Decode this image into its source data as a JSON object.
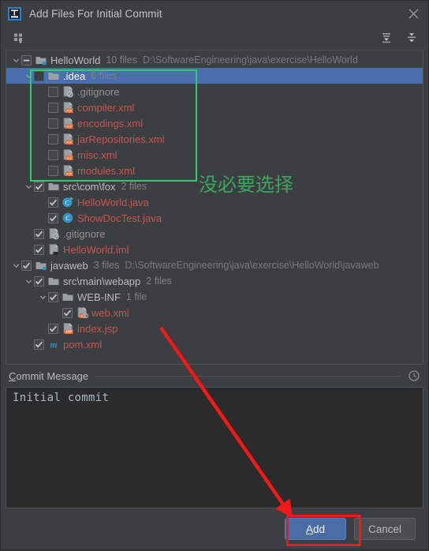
{
  "window": {
    "title": "Add Files For Initial Commit",
    "logo_icon": "intellij-idea-logo-icon",
    "close_icon": "close-icon"
  },
  "toolbar": {
    "group_by_icon": "group-by-directory-icon",
    "expand_all_icon": "expand-all-icon",
    "collapse_all_icon": "collapse-all-icon"
  },
  "tree": {
    "nodes": [
      {
        "name": "HelloWorld",
        "count": "10 files",
        "path": "D:\\SoftwareEngineering\\java\\exercise\\HelloWorld",
        "icon": "module-folder-icon",
        "checkbox": "indeterminate",
        "expanded": true,
        "indent": 1,
        "selected": false,
        "name_style": "folder"
      },
      {
        "name": ".idea",
        "count": "6 files",
        "path": "",
        "icon": "folder-icon",
        "checkbox": "unchecked",
        "expanded": true,
        "indent": 2,
        "selected": true,
        "name_style": "onsel"
      },
      {
        "name": ".gitignore",
        "count": "",
        "path": "",
        "icon": "gitignore-file-icon",
        "checkbox": "unchecked",
        "expanded": null,
        "indent": 3,
        "selected": false,
        "name_style": "ignored"
      },
      {
        "name": "compiler.xml",
        "count": "",
        "path": "",
        "icon": "xml-file-icon",
        "checkbox": "unchecked",
        "expanded": null,
        "indent": 3,
        "selected": false,
        "name_style": "newfile"
      },
      {
        "name": "encodings.xml",
        "count": "",
        "path": "",
        "icon": "xml-file-icon",
        "checkbox": "unchecked",
        "expanded": null,
        "indent": 3,
        "selected": false,
        "name_style": "newfile"
      },
      {
        "name": "jarRepositories.xml",
        "count": "",
        "path": "",
        "icon": "xml-file-icon",
        "checkbox": "unchecked",
        "expanded": null,
        "indent": 3,
        "selected": false,
        "name_style": "newfile"
      },
      {
        "name": "misc.xml",
        "count": "",
        "path": "",
        "icon": "xml-file-icon",
        "checkbox": "unchecked",
        "expanded": null,
        "indent": 3,
        "selected": false,
        "name_style": "newfile"
      },
      {
        "name": "modules.xml",
        "count": "",
        "path": "",
        "icon": "xml-file-icon",
        "checkbox": "unchecked",
        "expanded": null,
        "indent": 3,
        "selected": false,
        "name_style": "newfile"
      },
      {
        "name": "src\\com\\fox",
        "count": "2 files",
        "path": "",
        "icon": "folder-icon",
        "checkbox": "checked",
        "expanded": true,
        "indent": 2,
        "selected": false,
        "name_style": "folder"
      },
      {
        "name": "HelloWorld.java",
        "count": "",
        "path": "",
        "icon": "java-class-runnable-icon",
        "checkbox": "checked",
        "expanded": null,
        "indent": 3,
        "selected": false,
        "name_style": "newfile"
      },
      {
        "name": "ShowDocTest.java",
        "count": "",
        "path": "",
        "icon": "java-class-icon",
        "checkbox": "checked",
        "expanded": null,
        "indent": 3,
        "selected": false,
        "name_style": "newfile"
      },
      {
        "name": ".gitignore",
        "count": "",
        "path": "",
        "icon": "gitignore-file-icon",
        "checkbox": "checked",
        "expanded": null,
        "indent": 2,
        "selected": false,
        "name_style": "ignored"
      },
      {
        "name": "HelloWorld.iml",
        "count": "",
        "path": "",
        "icon": "iml-file-icon",
        "checkbox": "checked",
        "expanded": null,
        "indent": 2,
        "selected": false,
        "name_style": "newfile"
      },
      {
        "name": "javaweb",
        "count": "3 files",
        "path": "D:\\SoftwareEngineering\\java\\exercise\\HelloWorld\\javaweb",
        "icon": "module-folder-icon",
        "checkbox": "checked",
        "expanded": true,
        "indent": 1,
        "selected": false,
        "name_style": "folder"
      },
      {
        "name": "src\\main\\webapp",
        "count": "2 files",
        "path": "",
        "icon": "folder-icon",
        "checkbox": "checked",
        "expanded": true,
        "indent": 2,
        "selected": false,
        "name_style": "folder"
      },
      {
        "name": "WEB-INF",
        "count": "1 file",
        "path": "",
        "icon": "folder-icon",
        "checkbox": "checked",
        "expanded": true,
        "indent": 3,
        "selected": false,
        "name_style": "folder"
      },
      {
        "name": "web.xml",
        "count": "",
        "path": "",
        "icon": "web-xml-file-icon",
        "checkbox": "checked",
        "expanded": null,
        "indent": 4,
        "selected": false,
        "name_style": "newfile"
      },
      {
        "name": "index.jsp",
        "count": "",
        "path": "",
        "icon": "jsp-file-icon",
        "checkbox": "checked",
        "expanded": null,
        "indent": 3,
        "selected": false,
        "name_style": "newfile"
      },
      {
        "name": "pom.xml",
        "count": "",
        "path": "",
        "icon": "maven-pom-icon",
        "checkbox": "checked",
        "expanded": null,
        "indent": 2,
        "selected": false,
        "name_style": "newfile"
      }
    ]
  },
  "annotations": {
    "green_box_label": "green-highlight-box",
    "chinese_note": "没必要选择",
    "red_arrow_label": "red-pointer-arrow",
    "red_box_label": "red-highlight-box"
  },
  "commit_message": {
    "label_mnemonic": "C",
    "label_rest": "ommit Message",
    "value": "Initial commit",
    "placeholder": "",
    "history_icon": "clock-history-icon"
  },
  "buttons": {
    "add_mnemonic": "A",
    "add_rest": "dd",
    "cancel_label": "Cancel"
  },
  "colors": {
    "accent_selection": "#4b6eaf",
    "new_file_text": "#c75450",
    "annotation_green": "#2ecc71",
    "annotation_red": "#f01818",
    "primary_button": "#4a6da7"
  }
}
